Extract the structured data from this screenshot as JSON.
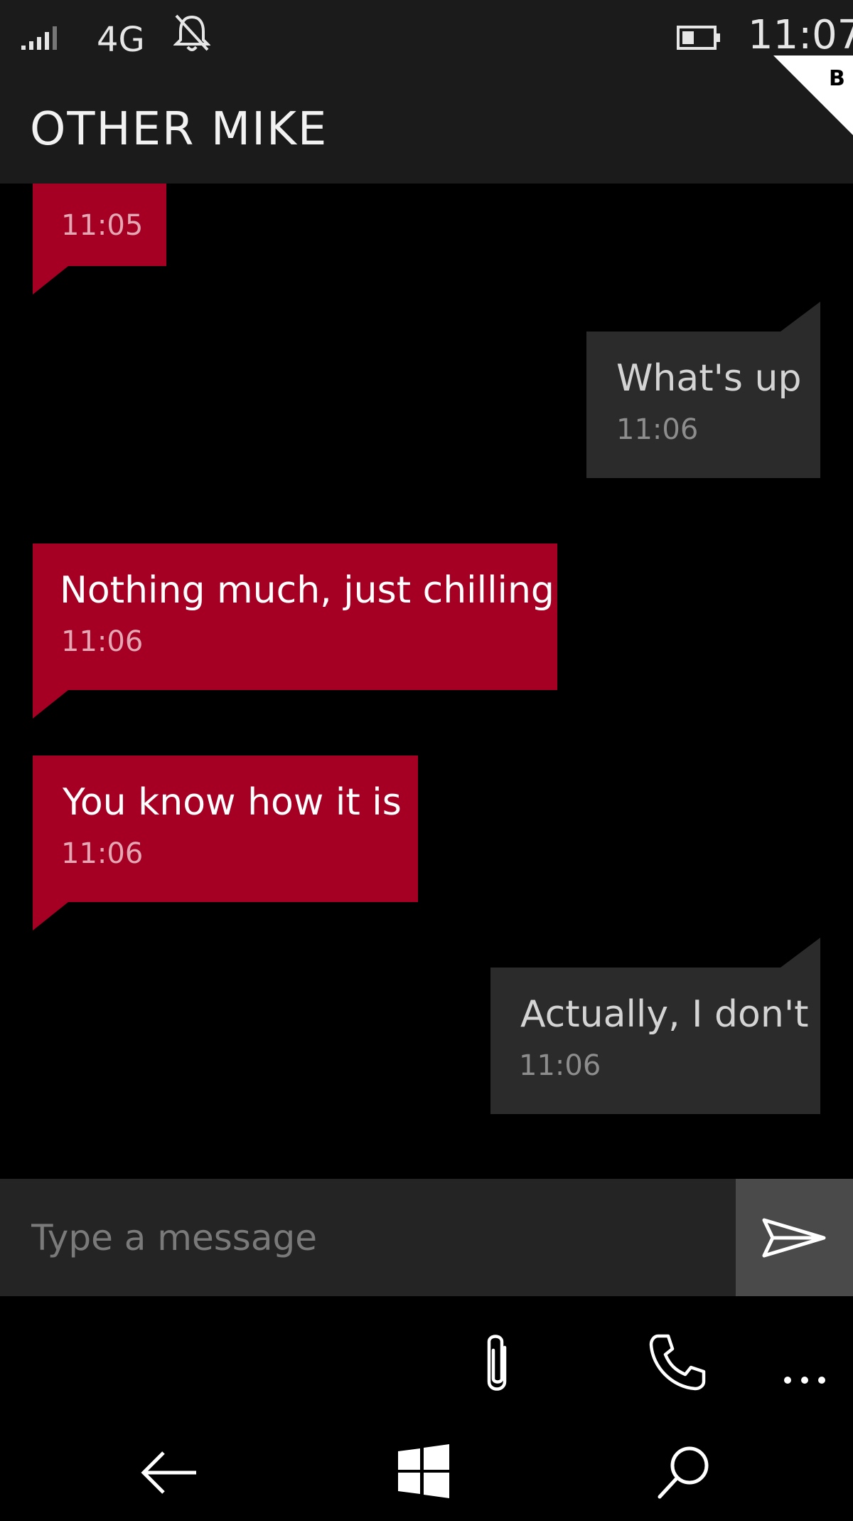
{
  "status_bar": {
    "network": "4G",
    "time": "11:07",
    "battery_level": 0.4,
    "icons": [
      "signal-icon",
      "silent-bell-icon",
      "battery-icon"
    ]
  },
  "corner_badge": "B",
  "header": {
    "title": "OTHER MIKE"
  },
  "messages": [
    {
      "direction": "received",
      "text": "",
      "time": "11:05"
    },
    {
      "direction": "sent",
      "text": "What's up",
      "time": "11:06"
    },
    {
      "direction": "received",
      "text": "Nothing much, just chilling",
      "time": "11:06"
    },
    {
      "direction": "received",
      "text": "You know how it is",
      "time": "11:06"
    },
    {
      "direction": "sent",
      "text": "Actually, I don't",
      "time": "11:06"
    }
  ],
  "composer": {
    "placeholder": "Type a message",
    "value": ""
  },
  "app_bar": {
    "icons": [
      "attach-icon",
      "phone-icon",
      "more-icon"
    ]
  },
  "nav_bar": {
    "icons": [
      "back-icon",
      "windows-start-icon",
      "search-icon"
    ]
  },
  "colors": {
    "received_bubble": "#a50024",
    "sent_bubble": "#2b2b2b",
    "chrome": "#1b1b1b",
    "send_button": "#4a4a4a"
  }
}
